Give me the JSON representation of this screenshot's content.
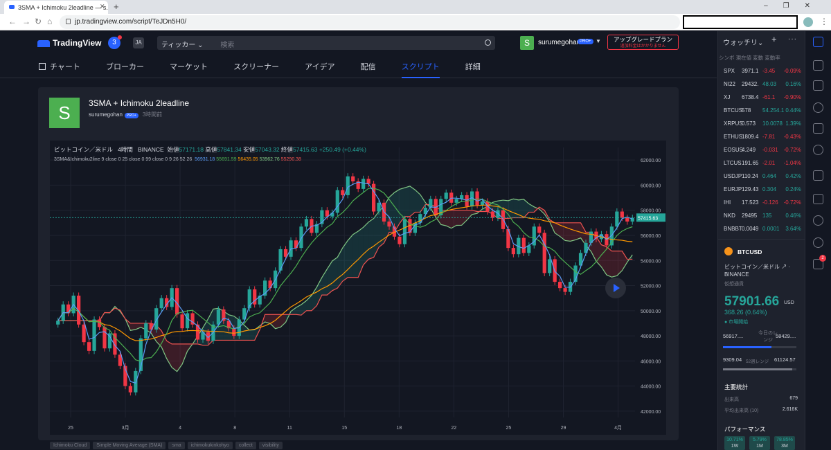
{
  "browser": {
    "tab_title": "3SMA + Ichimoku 2leadline — s...",
    "url": "jp.tradingview.com/script/TeJDn5H0/"
  },
  "header": {
    "logo": "TradingView",
    "notif_count": "3",
    "lang": "JA",
    "ticker_label": "ティッカー ⌄",
    "search_placeholder": "検索",
    "username": "surumegohan",
    "pro_badge": "PRO+",
    "upgrade_title": "アップグレードプラン",
    "upgrade_sub": "追加料金はかかりません"
  },
  "nav": [
    "チャート",
    "ブローカー",
    "マーケット",
    "スクリーナー",
    "アイデア",
    "配信",
    "スクリプト",
    "詳細"
  ],
  "script": {
    "avatar_letter": "S",
    "title": "3SMA + Ichimoku 2leadline",
    "author": "surumegohan",
    "pro_badge": "PRO+",
    "time_ago": "3時間前"
  },
  "legend": {
    "symbol": "ビットコイン／米ドル",
    "interval": "4時間",
    "exchange": "BINANCE",
    "open_label": "始値",
    "open": "57171.18",
    "high_label": "高値",
    "high": "57841.34",
    "low_label": "安値",
    "low": "57043.32",
    "close_label": "終値",
    "close": "57415.63",
    "change": "+250.49 (+0.44%)",
    "study": "3SMA&Ichimoku2line 9 close 0 25 close 0 99 close 0 9 26 52 26",
    "study_values": [
      {
        "v": "56931.18",
        "color": "#5b9cf6"
      },
      {
        "v": "55691.59",
        "color": "#4caf50"
      },
      {
        "v": "56435.05",
        "color": "#ff9800"
      },
      {
        "v": "53962.76",
        "color": "#81c784"
      },
      {
        "v": "55290.38",
        "color": "#ef5350"
      }
    ]
  },
  "tags": [
    "Ichimoku Cloud",
    "Simple Moving Average (SMA)",
    "sma",
    "ichimokukinkohyo",
    "collect",
    "visibility"
  ],
  "chart_data": {
    "type": "candlestick",
    "x_ticks": [
      "25",
      "3月",
      "4",
      "8",
      "11",
      "15",
      "18",
      "22",
      "25",
      "29",
      "4月"
    ],
    "y_ticks": [
      42000,
      44000,
      46000,
      48000,
      50000,
      52000,
      54000,
      56000,
      58000,
      60000,
      62000
    ],
    "ylim": [
      41500,
      63000
    ],
    "last_price": "57415.63",
    "closes": [
      49200,
      50500,
      49800,
      51200,
      48900,
      47500,
      46800,
      49300,
      48700,
      47000,
      48200,
      46500,
      45600,
      44000,
      43500,
      45200,
      47800,
      49000,
      48500,
      50200,
      51000,
      50300,
      51800,
      49700,
      48600,
      49800,
      48900,
      47700,
      48300,
      47600,
      48900,
      50100,
      49200,
      48600,
      48000,
      49300,
      50200,
      51700,
      50500,
      51200,
      52400,
      51800,
      53200,
      54900,
      54300,
      55600,
      55000,
      56700,
      57300,
      56200,
      56900,
      58000,
      57500,
      57800,
      59600,
      59200,
      60700,
      60300,
      59700,
      60500,
      60100,
      57900,
      58600,
      57100,
      56700,
      55900,
      55300,
      57300,
      56200,
      57000,
      57700,
      58200,
      58900,
      57600,
      58900,
      59400,
      58600,
      58900,
      59200,
      58300,
      59500,
      58400,
      58700,
      57900,
      57400,
      58000,
      56500,
      55000,
      54500,
      55800,
      54600,
      55200,
      56700,
      56200,
      53000,
      54100,
      52300,
      51800,
      51500,
      52300,
      53600,
      54600,
      55400,
      56300,
      55700,
      56100,
      55200,
      56700,
      57900,
      57400,
      57100,
      57400
    ]
  },
  "watchlist": {
    "title": "ウォッチリ⌄",
    "header": "シンボ 現在値  変動  変動率",
    "rows": [
      {
        "sym": "SPX",
        "price": "3971.1",
        "chg": "-3.45",
        "pct": "-0.09%",
        "dir": "dn"
      },
      {
        "sym": "NI22",
        "price": "29432.",
        "chg": "48.03",
        "pct": "0.16%",
        "dir": "up"
      },
      {
        "sym": "XJ",
        "price": "6738.4",
        "chg": "-61.1",
        "pct": "-0.90%",
        "dir": "dn"
      },
      {
        "sym": "BTCUS",
        "price": "578",
        "chg": "54.254.1",
        "pct": "0.44%",
        "dir": "up"
      },
      {
        "sym": "XRPUS",
        "price": "0.573",
        "chg": "10.0078",
        "pct": "1.39%",
        "dir": "up"
      },
      {
        "sym": "ETHUS",
        "price": "1809.4",
        "chg": "-7.81",
        "pct": "-0.43%",
        "dir": "dn"
      },
      {
        "sym": "EOSUS",
        "price": "4.249",
        "chg": "-0.031",
        "pct": "-0.72%",
        "dir": "dn"
      },
      {
        "sym": "LTCUS",
        "price": "191.65",
        "chg": "-2.01",
        "pct": "-1.04%",
        "dir": "dn"
      },
      {
        "sym": "USDJP",
        "price": "110.24",
        "chg": "0.464",
        "pct": "0.42%",
        "dir": "up"
      },
      {
        "sym": "EURJP",
        "price": "129.43",
        "chg": "0.304",
        "pct": "0.24%",
        "dir": "up"
      },
      {
        "sym": "IHI",
        "price": "17.523",
        "chg": "-0.126",
        "pct": "-0.72%",
        "dir": "dn"
      },
      {
        "sym": "NKD",
        "price": "29495",
        "chg": "135",
        "pct": "0.46%",
        "dir": "up"
      },
      {
        "sym": "BNBBT",
        "price": "0.0049",
        "chg": "0.0001",
        "pct": "3.64%",
        "dir": "up"
      }
    ]
  },
  "details": {
    "symbol": "BTCUSD",
    "desc": "ビットコイン／米ドル ↗ · BINANCE",
    "category": "仮想通貨",
    "price": "57901.66",
    "currency": "USD",
    "change": "368.26 (0.64%)",
    "market": "● 市場開始",
    "day_low": "56917....",
    "day_label": "今日のレンジ",
    "day_high": "58429....",
    "wk_low": "9309.04",
    "wk_label": "52週レンジ",
    "wk_high": "61124.57",
    "stats_title": "主要統計",
    "vol_label": "出来高",
    "vol": "679",
    "avgvol_label": "平均出来高 (10)",
    "avgvol": "2.616K",
    "perf_title": "パフォーマンス",
    "perf": [
      {
        "v": "10.71%",
        "p": "1W"
      },
      {
        "v": "5.79%",
        "p": "1M"
      },
      {
        "v": "78.85%",
        "p": "3M"
      }
    ]
  },
  "colors": {
    "up": "#26a69a",
    "down": "#f23645",
    "accent": "#2962ff"
  }
}
